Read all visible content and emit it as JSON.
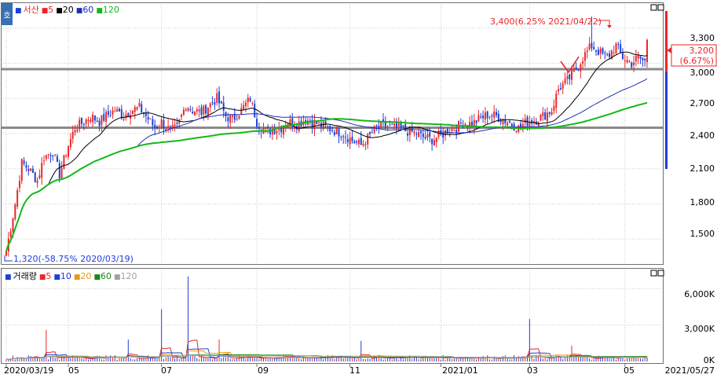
{
  "price_panel": {
    "side_tab": "호",
    "legend": {
      "square": "■",
      "name": "서산",
      "ma5": "5",
      "ma20": "20",
      "ma60": "60",
      "ma120": "120"
    },
    "current_price": "3,200",
    "current_change": "(6.67%)",
    "high_annotation": "3,400(6.25% 2021/04/22)",
    "low_annotation": "1,320(-58.75% 2020/03/19)",
    "y_ticks": [
      "3,300",
      "3,000",
      "2,700",
      "2,400",
      "2,100",
      "1,800",
      "1,500"
    ],
    "colors": {
      "up": "#e8262a",
      "down": "#1e3fd8",
      "ma5": "#000000",
      "ma20": "#1e2fb8",
      "ma60": "#16b816",
      "ma120": "#16b816",
      "hline": "#8a8a8a"
    }
  },
  "volume_panel": {
    "legend": {
      "square": "■",
      "name": "거래량",
      "ma5": "5",
      "ma10": "10",
      "ma20": "20",
      "ma60": "60",
      "ma120": "120"
    },
    "y_ticks": [
      "6,000K",
      "3,000K",
      "0K"
    ],
    "colors": {
      "ma5": "#e8262a",
      "ma10": "#1e3fd8",
      "ma20": "#e89a16",
      "ma60": "#168a16",
      "ma120": "#a0a0a0"
    }
  },
  "x_axis": {
    "labels": [
      "2020/03/19",
      "05",
      "07",
      "09",
      "11",
      "2021/01",
      "03",
      "05",
      "2021/05/27"
    ]
  },
  "chart_data": {
    "type": "candlestick",
    "title": "서산",
    "price_range": [
      1300,
      3500
    ],
    "volume_range": [
      0,
      7500
    ],
    "volume_unit": "K",
    "horizontal_lines": [
      2950,
      2450
    ],
    "x_month_ticks": [
      "2020/03/19",
      "05",
      "07",
      "09",
      "11",
      "2021/01",
      "03",
      "05"
    ],
    "high": {
      "value": 3400,
      "pct": "6.25%",
      "date": "2021/04/22"
    },
    "low": {
      "value": 1320,
      "pct": "-58.75%",
      "date": "2020/03/19"
    },
    "last": {
      "value": 3200,
      "pct": "6.67%",
      "date": "2021/05/27"
    },
    "price_anchors": [
      [
        0,
        1400
      ],
      [
        4,
        1800
      ],
      [
        7,
        2150
      ],
      [
        10,
        2100
      ],
      [
        14,
        2000
      ],
      [
        17,
        2200
      ],
      [
        21,
        2250
      ],
      [
        24,
        2050
      ],
      [
        28,
        2300
      ],
      [
        31,
        2450
      ],
      [
        35,
        2500
      ],
      [
        38,
        2550
      ],
      [
        42,
        2500
      ],
      [
        45,
        2550
      ],
      [
        49,
        2600
      ],
      [
        53,
        2550
      ],
      [
        56,
        2600
      ],
      [
        60,
        2620
      ],
      [
        63,
        2550
      ],
      [
        67,
        2450
      ],
      [
        70,
        2500
      ],
      [
        74,
        2420
      ],
      [
        77,
        2450
      ],
      [
        81,
        2650
      ],
      [
        84,
        2600
      ],
      [
        88,
        2580
      ],
      [
        92,
        2650
      ],
      [
        95,
        2700
      ],
      [
        99,
        2550
      ],
      [
        102,
        2520
      ],
      [
        106,
        2600
      ],
      [
        110,
        2700
      ],
      [
        113,
        2500
      ],
      [
        117,
        2420
      ],
      [
        120,
        2430
      ],
      [
        124,
        2450
      ],
      [
        127,
        2500
      ],
      [
        131,
        2480
      ],
      [
        135,
        2520
      ],
      [
        138,
        2500
      ],
      [
        142,
        2470
      ],
      [
        145,
        2450
      ],
      [
        149,
        2420
      ],
      [
        152,
        2400
      ],
      [
        156,
        2340
      ],
      [
        160,
        2300
      ],
      [
        163,
        2360
      ],
      [
        167,
        2450
      ],
      [
        170,
        2470
      ],
      [
        174,
        2450
      ],
      [
        178,
        2440
      ],
      [
        181,
        2420
      ],
      [
        185,
        2400
      ],
      [
        188,
        2370
      ],
      [
        192,
        2350
      ],
      [
        196,
        2380
      ],
      [
        199,
        2430
      ],
      [
        203,
        2450
      ],
      [
        206,
        2500
      ],
      [
        210,
        2480
      ],
      [
        213,
        2520
      ],
      [
        217,
        2560
      ],
      [
        221,
        2550
      ],
      [
        224,
        2520
      ],
      [
        228,
        2480
      ],
      [
        231,
        2450
      ],
      [
        235,
        2500
      ],
      [
        239,
        2520
      ],
      [
        242,
        2550
      ],
      [
        246,
        2600
      ],
      [
        249,
        2780
      ],
      [
        253,
        2850
      ],
      [
        257,
        2950
      ],
      [
        260,
        3050
      ],
      [
        264,
        3150
      ],
      [
        267,
        3100
      ],
      [
        271,
        3050
      ],
      [
        275,
        3150
      ],
      [
        278,
        3050
      ],
      [
        282,
        3000
      ],
      [
        285,
        3050
      ],
      [
        289,
        3000
      ]
    ],
    "volume_spikes": [
      {
        "date": "2020/04",
        "value": 2600
      },
      {
        "date": "2020/06",
        "value": 1800
      },
      {
        "date": "2020/07",
        "value": 4300
      },
      {
        "date": "2020/07",
        "value": 7000
      },
      {
        "date": "2020/08",
        "value": 1800
      },
      {
        "date": "2020/11",
        "value": 1700
      },
      {
        "date": "2021/03",
        "value": 3500
      },
      {
        "date": "2021/04",
        "value": 1300
      }
    ]
  }
}
